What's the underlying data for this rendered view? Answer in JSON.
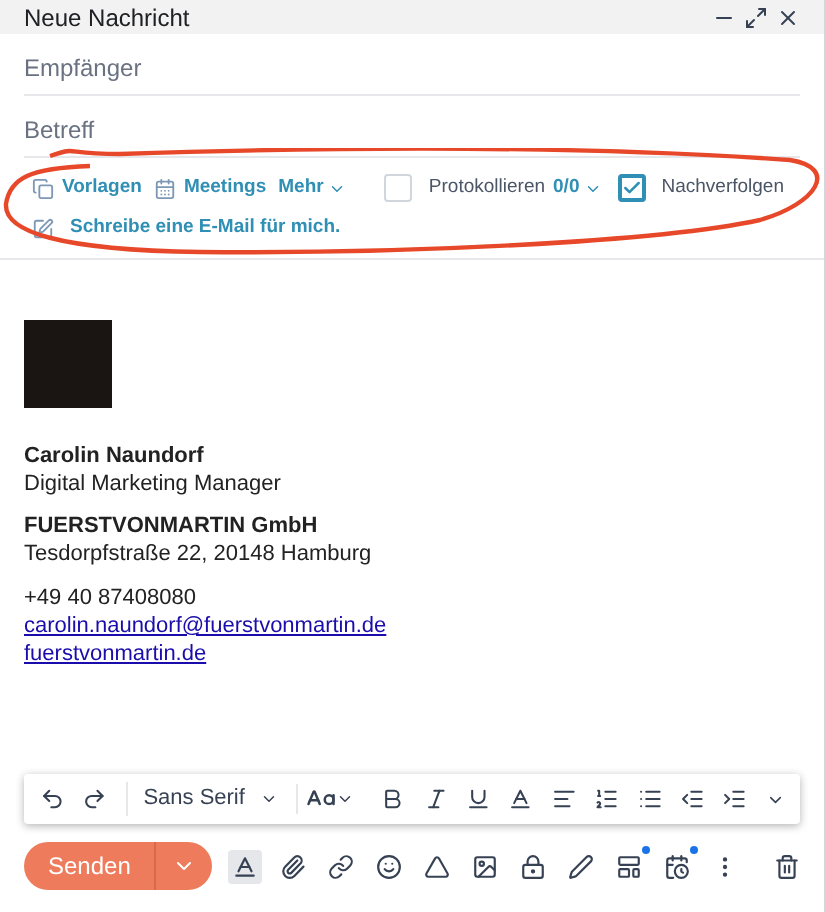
{
  "window": {
    "title": "Neue Nachricht"
  },
  "fields": [
    {
      "placeholder": "Empfänger"
    },
    {
      "placeholder": "Betreff"
    }
  ],
  "tools": {
    "links": [
      {
        "kind": "templates",
        "label": "Vorlagen"
      },
      {
        "kind": "meetings",
        "label": "Meetings"
      }
    ],
    "more": "Mehr",
    "log": {
      "label": "Protokollieren",
      "count": "0/0",
      "checked": false
    },
    "track": {
      "label": "Nachverfolgen",
      "checked": true
    },
    "ai_link": "Schreibe eine E-Mail für mich."
  },
  "signature": {
    "name": "Carolin Naundorf",
    "role": "Digital Marketing Manager",
    "company": "FUERSTVONMARTIN GmbH",
    "address": "Tesdorpfstraße 22, 20148 Hamburg",
    "phone": "+49 40 87408080",
    "email": "carolin.naundorf@fuerstvonmartin.de",
    "website": "fuerstvonmartin.de"
  },
  "format_toolbar": {
    "font": "Sans Serif"
  },
  "send_button": "Senden",
  "bottom_tools": [
    {
      "kind": "formatting",
      "selected": true,
      "badge": false
    },
    {
      "kind": "attach",
      "selected": false,
      "badge": false
    },
    {
      "kind": "link",
      "selected": false,
      "badge": false
    },
    {
      "kind": "emoji",
      "selected": false,
      "badge": false
    },
    {
      "kind": "drive",
      "selected": false,
      "badge": false
    },
    {
      "kind": "photo",
      "selected": false,
      "badge": false
    },
    {
      "kind": "confidential",
      "selected": false,
      "badge": false
    },
    {
      "kind": "signature",
      "selected": false,
      "badge": false
    },
    {
      "kind": "layout",
      "selected": false,
      "badge": true
    },
    {
      "kind": "schedule",
      "selected": false,
      "badge": true
    },
    {
      "kind": "more",
      "selected": false,
      "badge": false
    }
  ]
}
